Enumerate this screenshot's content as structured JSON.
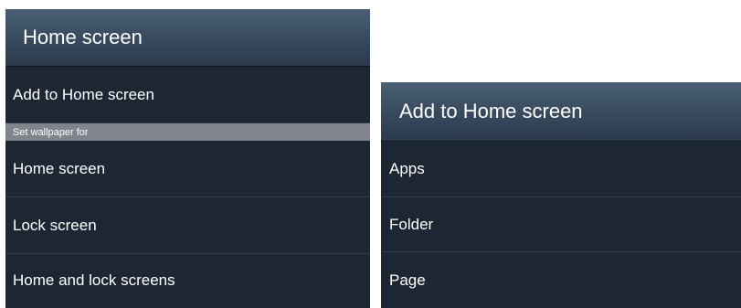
{
  "home_screen_dialog": {
    "title": "Home screen",
    "add_item": "Add to Home screen",
    "section_label": "Set wallpaper for",
    "items": [
      {
        "label": "Home screen"
      },
      {
        "label": "Lock screen"
      },
      {
        "label": "Home and lock screens"
      }
    ]
  },
  "add_to_home_dialog": {
    "title": "Add to Home screen",
    "items": [
      {
        "label": "Apps"
      },
      {
        "label": "Folder"
      },
      {
        "label": "Page"
      }
    ]
  },
  "colors": {
    "dialog_background": "#1c2733",
    "header_gradient_top": "#4a5f75",
    "section_header": "#7f858b",
    "text": "#ffffff"
  }
}
